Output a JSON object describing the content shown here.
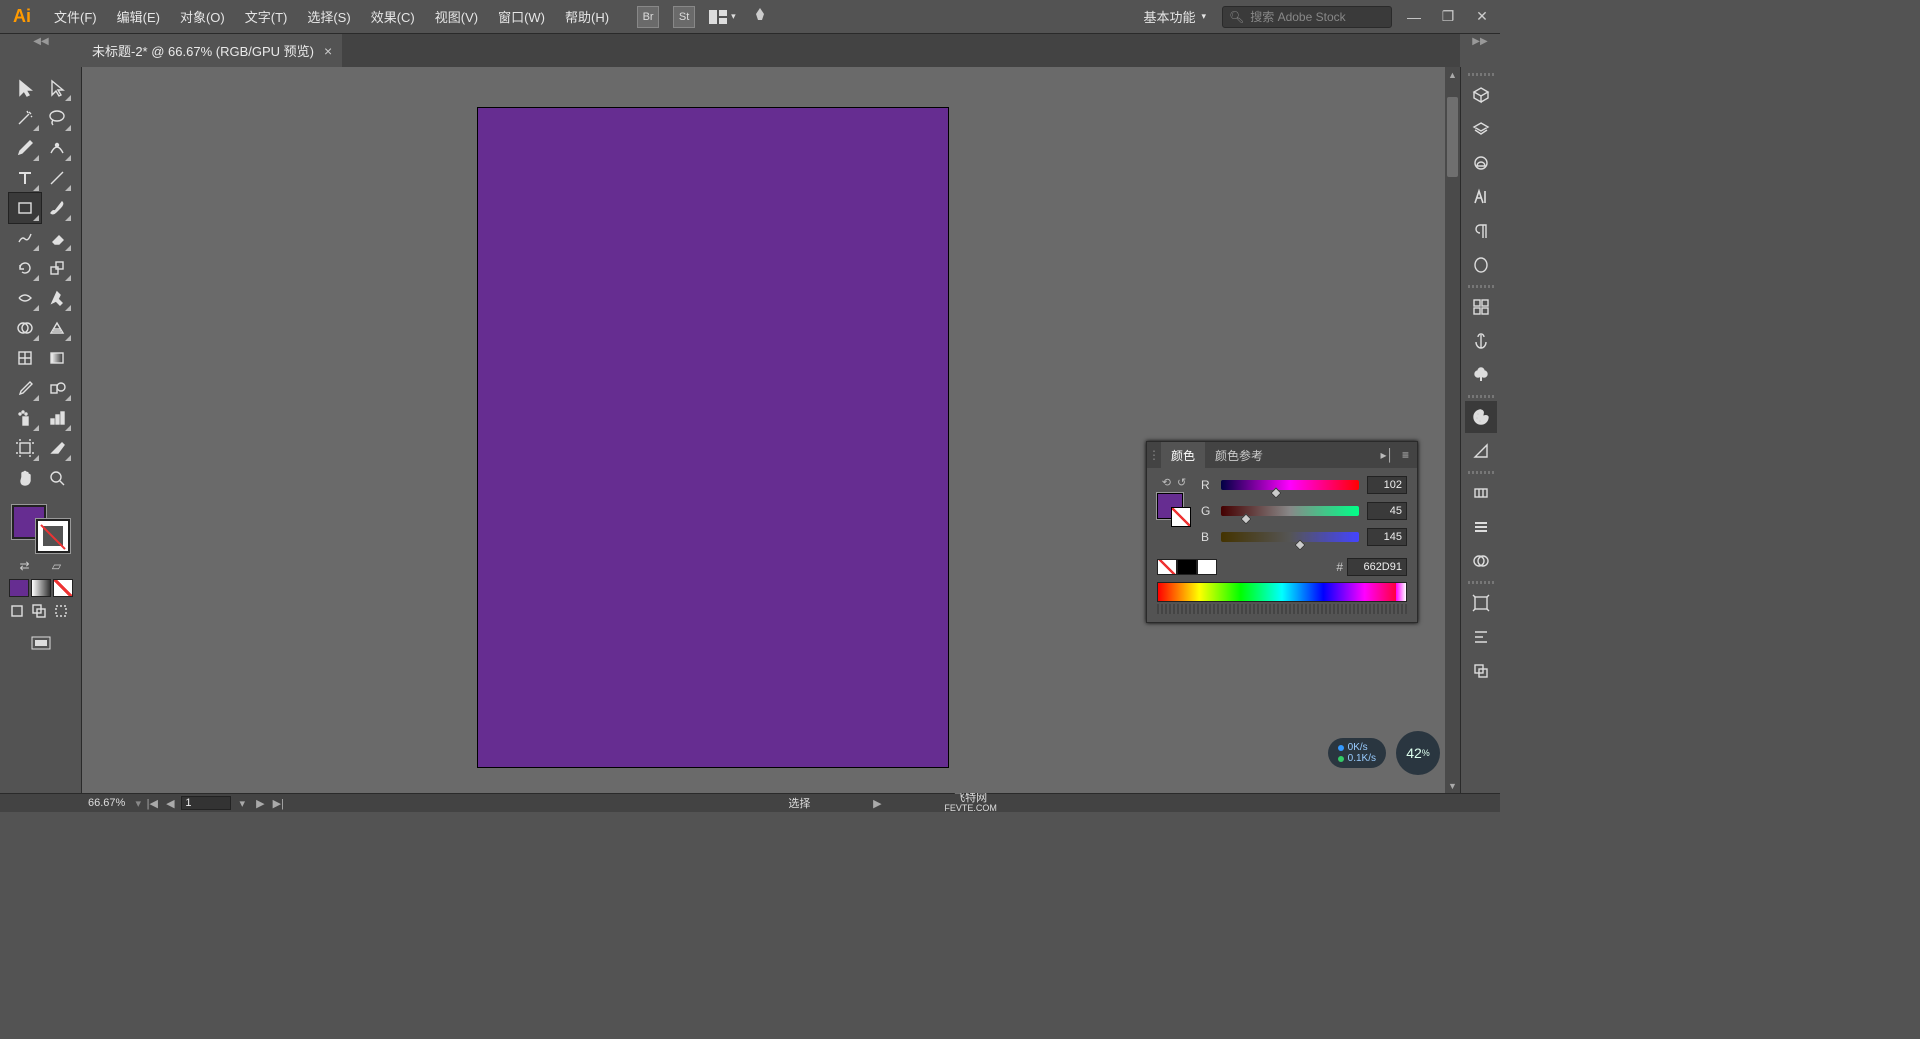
{
  "menu": {
    "file": "文件(F)",
    "edit": "编辑(E)",
    "object": "对象(O)",
    "type": "文字(T)",
    "select": "选择(S)",
    "effect": "效果(C)",
    "view": "视图(V)",
    "window": "窗口(W)",
    "help": "帮助(H)"
  },
  "topIcons": {
    "br": "Br",
    "st": "St"
  },
  "workspace": "基本功能",
  "search": {
    "placeholder": "搜索 Adobe Stock"
  },
  "docTab": "未标题-2* @ 66.67% (RGB/GPU 预览)",
  "colorPanel": {
    "tabColor": "颜色",
    "tabGuide": "颜色参考",
    "r": {
      "label": "R",
      "value": "102",
      "pct": 40
    },
    "g": {
      "label": "G",
      "value": "45",
      "pct": 18
    },
    "b": {
      "label": "B",
      "value": "145",
      "pct": 57
    },
    "hexLabel": "#",
    "hex": "662D91"
  },
  "status": {
    "zoom": "66.67%",
    "page": "1",
    "mode": "选择",
    "watermark": "飞特网",
    "url": "FEVTE.COM"
  },
  "net": {
    "up": "0K/s",
    "down": "0.1K/s",
    "big": "42",
    "bigSuffix": "%"
  },
  "colors": {
    "fill": "#662D91"
  }
}
